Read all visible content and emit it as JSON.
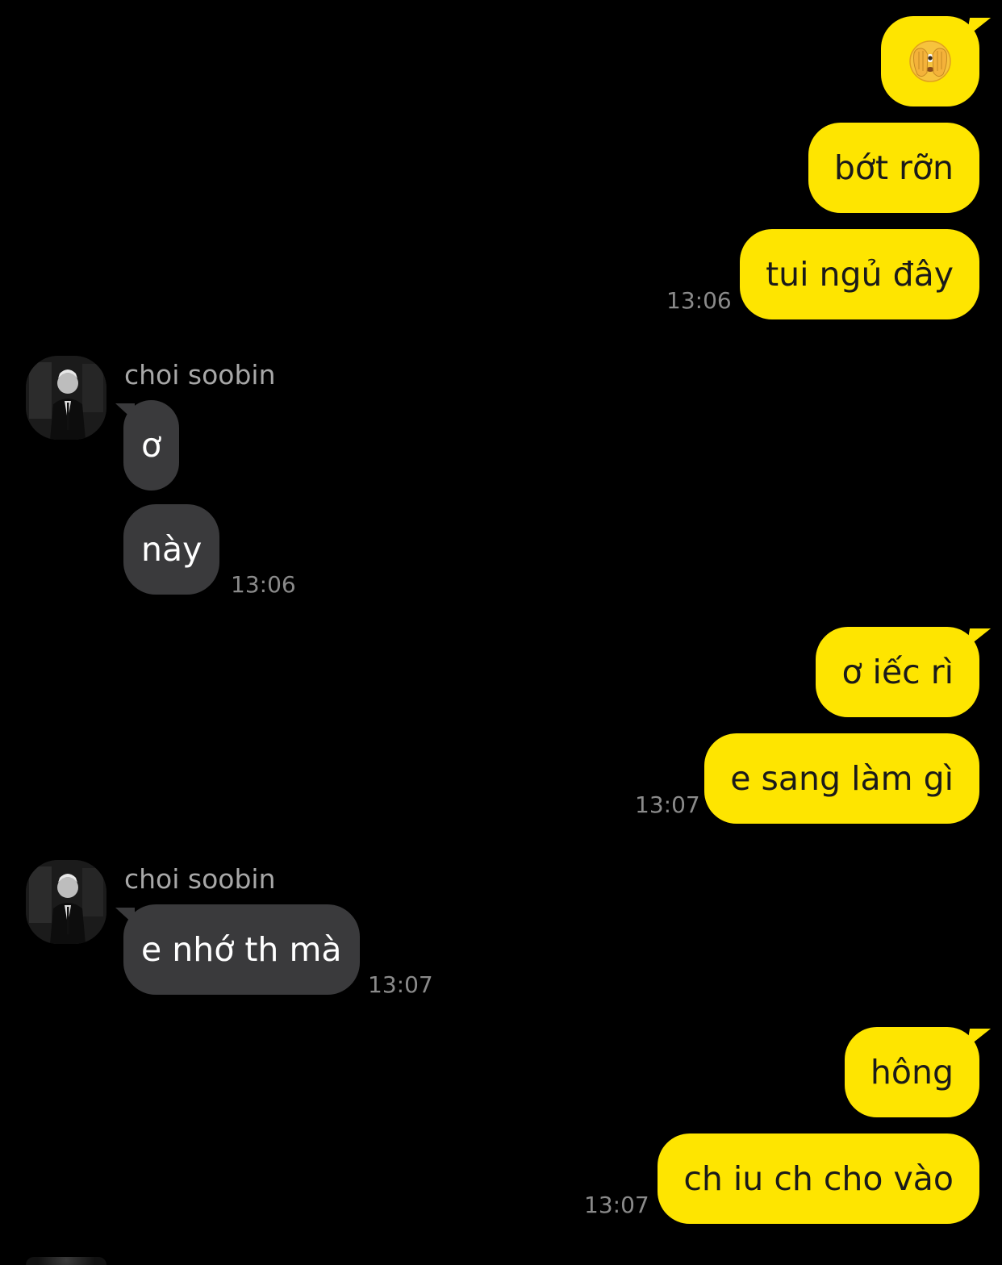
{
  "chat": {
    "contact_name": "choi soobin",
    "messages": [
      {
        "side": "out",
        "text": "",
        "emoji": "face-with-hand-over-mouth-peeking-emoji"
      },
      {
        "side": "out",
        "text": "bớt rỡn"
      },
      {
        "side": "out",
        "text": "tui ngủ đây",
        "time": "13:06"
      },
      {
        "side": "in",
        "sender": "choi soobin",
        "text": "ơ"
      },
      {
        "side": "in",
        "text": "này",
        "time": "13:06"
      },
      {
        "side": "out",
        "text": "ơ iếc rì"
      },
      {
        "side": "out",
        "text": "e sang làm gì",
        "time": "13:07"
      },
      {
        "side": "in",
        "sender": "choi soobin",
        "text": "e nhớ th mà",
        "time": "13:07"
      },
      {
        "side": "out",
        "text": "hông"
      },
      {
        "side": "out",
        "text": "ch iu ch cho vào",
        "time": "13:07"
      }
    ]
  },
  "colors": {
    "background": "#000000",
    "outgoing_bubble": "#FEE500",
    "incoming_bubble": "#3a3a3c",
    "timestamp": "#8a8a8a",
    "sender_name": "#a7a7a7"
  }
}
